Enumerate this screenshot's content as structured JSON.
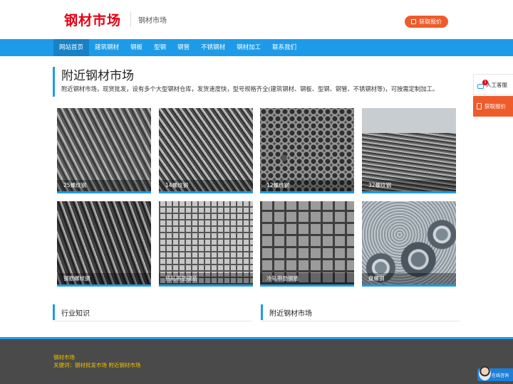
{
  "header": {
    "logo_text": "钢材市场",
    "subtitle": "钢材市场",
    "quote_button": "获取报价"
  },
  "nav": {
    "items": [
      "网站首页",
      "建筑钢材",
      "钢板",
      "型钢",
      "钢管",
      "不锈钢材",
      "钢材加工",
      "联系我们"
    ],
    "active_index": 0
  },
  "intro": {
    "title": "附近钢材市场",
    "text": "附近钢材市场，现货批发，设有多个大型钢材仓库，发货速度快，型号规格齐全(建筑钢材、钢板、型钢、钢管、不锈钢材等)，可按需定制加工。"
  },
  "products": [
    {
      "label": "25螺纹钢",
      "image": "rebar-bundle"
    },
    {
      "label": "14螺纹钢",
      "image": "rebar-bundle"
    },
    {
      "label": "12螺纹钢",
      "image": "rebar-ends"
    },
    {
      "label": "32螺纹钢",
      "image": "rebar-yard"
    },
    {
      "label": "钢筋螺纹钢",
      "image": "rebar-bundle-dark"
    },
    {
      "label": "热轧带肋钢筋",
      "image": "rebar-mesh"
    },
    {
      "label": "冷轧带肋钢筋",
      "image": "welded-mesh"
    },
    {
      "label": "盘螺钢",
      "image": "wire-coil"
    }
  ],
  "sections": {
    "left_title": "行业知识",
    "right_title": "附近钢材市场"
  },
  "footer": {
    "line1": "钢材市场",
    "line2": "关键词：钢材批发市场 附近钢材市场"
  },
  "side": {
    "service_label": "人工客服",
    "service_badge": "1",
    "quote_label": "获取报价",
    "online_label": "在线咨询"
  },
  "colors": {
    "brand_red": "#e60012",
    "nav_blue": "#1e9be8",
    "accent_orange": "#ef5c2b",
    "footer_text": "#f2c200"
  }
}
